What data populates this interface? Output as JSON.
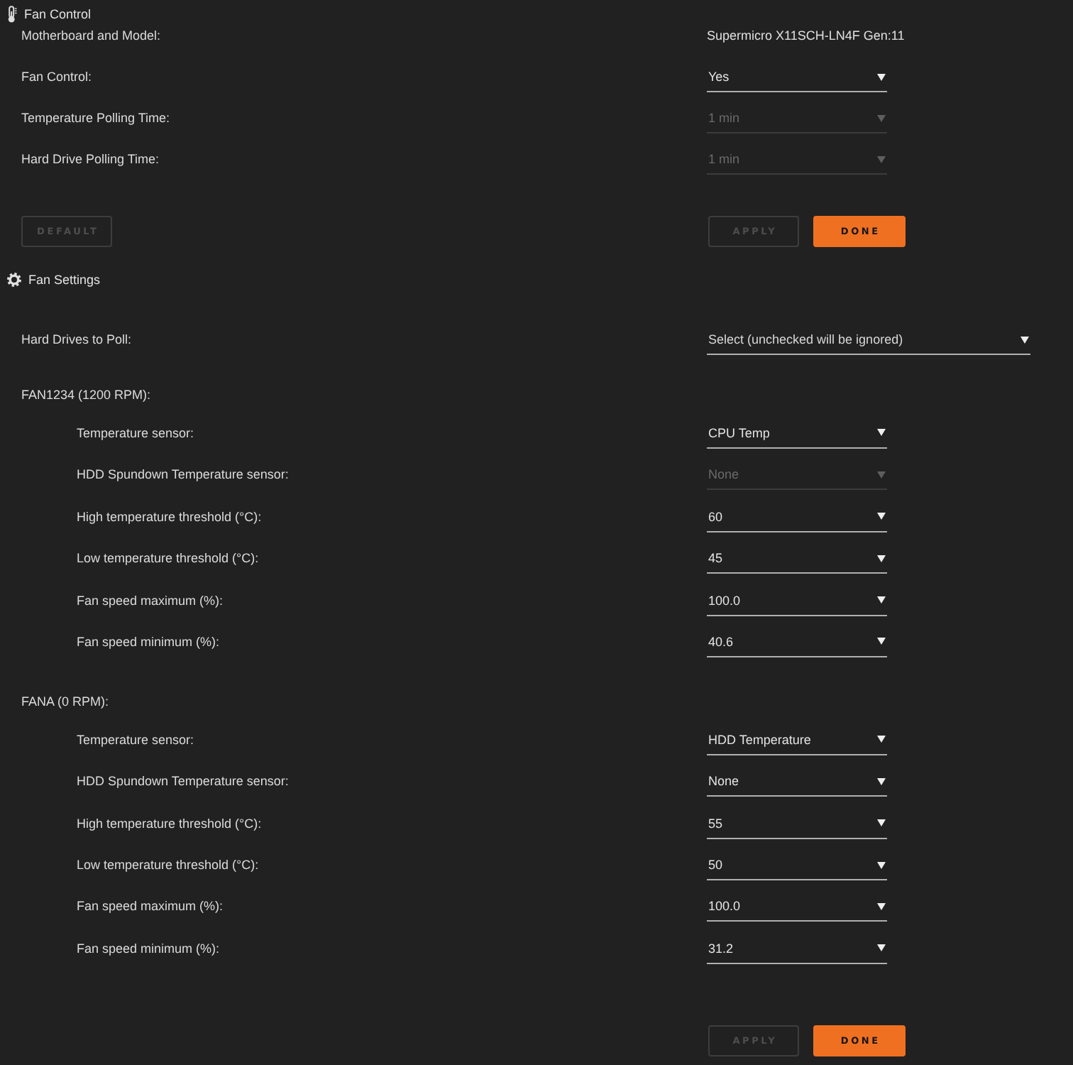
{
  "fan_control": {
    "title": "Fan Control",
    "rows": [
      {
        "kind": "text",
        "label": "Motherboard and Model:",
        "value": "Supermicro X11SCH-LN4F Gen:11"
      },
      {
        "kind": "select",
        "label": "Fan Control:",
        "value": "Yes",
        "disabled": false
      },
      {
        "kind": "select",
        "label": "Temperature Polling Time:",
        "value": "1 min",
        "disabled": true
      },
      {
        "kind": "select",
        "label": "Hard Drive Polling Time:",
        "value": "1 min",
        "disabled": true
      }
    ],
    "buttons_left": [
      {
        "label": "DEFAULT",
        "kind": "secondary",
        "disabled": true
      }
    ],
    "buttons_right": [
      {
        "label": "APPLY",
        "kind": "secondary",
        "disabled": true
      },
      {
        "label": "DONE",
        "kind": "primary",
        "disabled": false
      }
    ]
  },
  "fan_settings": {
    "title": "Fan Settings",
    "hard_drives": {
      "label": "Hard Drives to Poll:",
      "placeholder": "Select (unchecked will be ignored)"
    },
    "fans": [
      {
        "name": "FAN1234 (1200 RPM):",
        "settings": [
          {
            "label": "Temperature sensor:",
            "value": "CPU Temp",
            "disabled": false
          },
          {
            "label": "HDD Spundown Temperature sensor:",
            "value": "None",
            "disabled": true
          },
          {
            "label": "High temperature threshold (°C):",
            "value": "60",
            "disabled": false
          },
          {
            "label": "Low temperature threshold (°C):",
            "value": "45",
            "disabled": false
          },
          {
            "label": "Fan speed maximum (%):",
            "value": "100.0",
            "disabled": false
          },
          {
            "label": "Fan speed minimum (%):",
            "value": "40.6",
            "disabled": false
          }
        ]
      },
      {
        "name": "FANA (0 RPM):",
        "settings": [
          {
            "label": "Temperature sensor:",
            "value": "HDD Temperature",
            "disabled": false
          },
          {
            "label": "HDD Spundown Temperature sensor:",
            "value": "None",
            "disabled": false
          },
          {
            "label": "High temperature threshold (°C):",
            "value": "55",
            "disabled": false
          },
          {
            "label": "Low temperature threshold (°C):",
            "value": "50",
            "disabled": false
          },
          {
            "label": "Fan speed maximum (%):",
            "value": "100.0",
            "disabled": false
          },
          {
            "label": "Fan speed minimum (%):",
            "value": "31.2",
            "disabled": false
          }
        ]
      }
    ],
    "buttons": [
      {
        "label": "APPLY",
        "kind": "secondary",
        "disabled": true
      },
      {
        "label": "DONE",
        "kind": "primary",
        "disabled": false
      }
    ]
  }
}
